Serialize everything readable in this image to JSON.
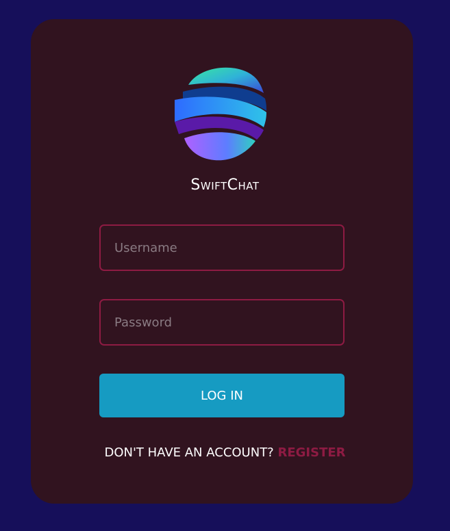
{
  "brand": {
    "name": "SwiftChat",
    "logo_icon": "globe-ribbon-logo"
  },
  "form": {
    "username_placeholder": "Username",
    "password_placeholder": "Password",
    "login_label": "LOG IN"
  },
  "footer": {
    "prompt": "DON'T HAVE AN ACCOUNT?",
    "register_label": "REGISTER"
  },
  "colors": {
    "background": "#160f5a",
    "card": "#31131f",
    "accent": "#8e1b43",
    "button": "#169bc2"
  }
}
